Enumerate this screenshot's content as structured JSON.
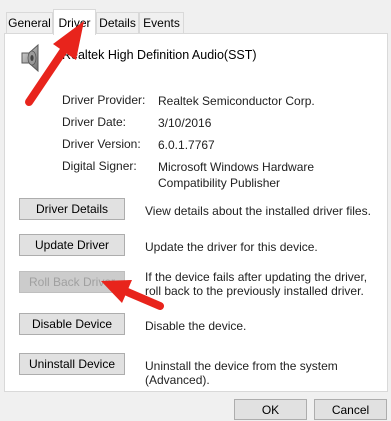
{
  "tabs": [
    {
      "label": "General"
    },
    {
      "label": "Driver"
    },
    {
      "label": "Details"
    },
    {
      "label": "Events"
    }
  ],
  "device": {
    "name": "Realtek High Definition Audio(SST)",
    "icon": "speaker-icon"
  },
  "properties": [
    {
      "label": "Driver Provider:",
      "value": "Realtek Semiconductor Corp."
    },
    {
      "label": "Driver Date:",
      "value": "3/10/2016"
    },
    {
      "label": "Driver Version:",
      "value": "6.0.1.7767"
    },
    {
      "label": "Digital Signer:",
      "value": "Microsoft Windows Hardware Compatibility Publisher"
    }
  ],
  "actions": [
    {
      "label": "Driver Details",
      "description": "View details about the installed driver files.",
      "enabled": true
    },
    {
      "label": "Update Driver",
      "description": "Update the driver for this device.",
      "enabled": true
    },
    {
      "label": "Roll Back Driver",
      "description": "If the device fails after updating the driver, roll back to the previously installed driver.",
      "enabled": false
    },
    {
      "label": "Disable Device",
      "description": "Disable the device.",
      "enabled": true
    },
    {
      "label": "Uninstall Device",
      "description": "Uninstall the device from the system (Advanced).",
      "enabled": true
    }
  ],
  "footer": {
    "ok_label": "OK",
    "cancel_label": "Cancel"
  },
  "colors": {
    "annotation_arrow": "#e8241c",
    "panel": "#ffffff",
    "dialog": "#f0f0f0"
  }
}
